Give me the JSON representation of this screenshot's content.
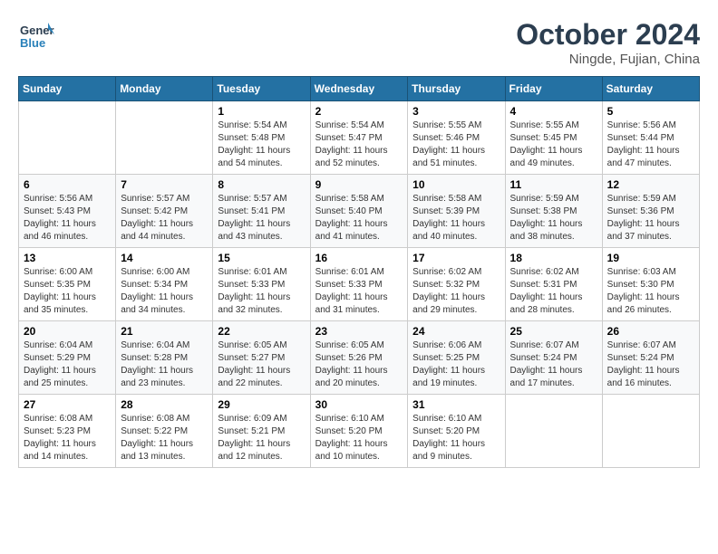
{
  "logo": {
    "general": "General",
    "blue": "Blue"
  },
  "title": "October 2024",
  "location": "Ningde, Fujian, China",
  "days_of_week": [
    "Sunday",
    "Monday",
    "Tuesday",
    "Wednesday",
    "Thursday",
    "Friday",
    "Saturday"
  ],
  "weeks": [
    [
      {
        "day": "",
        "info": ""
      },
      {
        "day": "",
        "info": ""
      },
      {
        "day": "1",
        "info": "Sunrise: 5:54 AM\nSunset: 5:48 PM\nDaylight: 11 hours and 54 minutes."
      },
      {
        "day": "2",
        "info": "Sunrise: 5:54 AM\nSunset: 5:47 PM\nDaylight: 11 hours and 52 minutes."
      },
      {
        "day": "3",
        "info": "Sunrise: 5:55 AM\nSunset: 5:46 PM\nDaylight: 11 hours and 51 minutes."
      },
      {
        "day": "4",
        "info": "Sunrise: 5:55 AM\nSunset: 5:45 PM\nDaylight: 11 hours and 49 minutes."
      },
      {
        "day": "5",
        "info": "Sunrise: 5:56 AM\nSunset: 5:44 PM\nDaylight: 11 hours and 47 minutes."
      }
    ],
    [
      {
        "day": "6",
        "info": "Sunrise: 5:56 AM\nSunset: 5:43 PM\nDaylight: 11 hours and 46 minutes."
      },
      {
        "day": "7",
        "info": "Sunrise: 5:57 AM\nSunset: 5:42 PM\nDaylight: 11 hours and 44 minutes."
      },
      {
        "day": "8",
        "info": "Sunrise: 5:57 AM\nSunset: 5:41 PM\nDaylight: 11 hours and 43 minutes."
      },
      {
        "day": "9",
        "info": "Sunrise: 5:58 AM\nSunset: 5:40 PM\nDaylight: 11 hours and 41 minutes."
      },
      {
        "day": "10",
        "info": "Sunrise: 5:58 AM\nSunset: 5:39 PM\nDaylight: 11 hours and 40 minutes."
      },
      {
        "day": "11",
        "info": "Sunrise: 5:59 AM\nSunset: 5:38 PM\nDaylight: 11 hours and 38 minutes."
      },
      {
        "day": "12",
        "info": "Sunrise: 5:59 AM\nSunset: 5:36 PM\nDaylight: 11 hours and 37 minutes."
      }
    ],
    [
      {
        "day": "13",
        "info": "Sunrise: 6:00 AM\nSunset: 5:35 PM\nDaylight: 11 hours and 35 minutes."
      },
      {
        "day": "14",
        "info": "Sunrise: 6:00 AM\nSunset: 5:34 PM\nDaylight: 11 hours and 34 minutes."
      },
      {
        "day": "15",
        "info": "Sunrise: 6:01 AM\nSunset: 5:33 PM\nDaylight: 11 hours and 32 minutes."
      },
      {
        "day": "16",
        "info": "Sunrise: 6:01 AM\nSunset: 5:33 PM\nDaylight: 11 hours and 31 minutes."
      },
      {
        "day": "17",
        "info": "Sunrise: 6:02 AM\nSunset: 5:32 PM\nDaylight: 11 hours and 29 minutes."
      },
      {
        "day": "18",
        "info": "Sunrise: 6:02 AM\nSunset: 5:31 PM\nDaylight: 11 hours and 28 minutes."
      },
      {
        "day": "19",
        "info": "Sunrise: 6:03 AM\nSunset: 5:30 PM\nDaylight: 11 hours and 26 minutes."
      }
    ],
    [
      {
        "day": "20",
        "info": "Sunrise: 6:04 AM\nSunset: 5:29 PM\nDaylight: 11 hours and 25 minutes."
      },
      {
        "day": "21",
        "info": "Sunrise: 6:04 AM\nSunset: 5:28 PM\nDaylight: 11 hours and 23 minutes."
      },
      {
        "day": "22",
        "info": "Sunrise: 6:05 AM\nSunset: 5:27 PM\nDaylight: 11 hours and 22 minutes."
      },
      {
        "day": "23",
        "info": "Sunrise: 6:05 AM\nSunset: 5:26 PM\nDaylight: 11 hours and 20 minutes."
      },
      {
        "day": "24",
        "info": "Sunrise: 6:06 AM\nSunset: 5:25 PM\nDaylight: 11 hours and 19 minutes."
      },
      {
        "day": "25",
        "info": "Sunrise: 6:07 AM\nSunset: 5:24 PM\nDaylight: 11 hours and 17 minutes."
      },
      {
        "day": "26",
        "info": "Sunrise: 6:07 AM\nSunset: 5:24 PM\nDaylight: 11 hours and 16 minutes."
      }
    ],
    [
      {
        "day": "27",
        "info": "Sunrise: 6:08 AM\nSunset: 5:23 PM\nDaylight: 11 hours and 14 minutes."
      },
      {
        "day": "28",
        "info": "Sunrise: 6:08 AM\nSunset: 5:22 PM\nDaylight: 11 hours and 13 minutes."
      },
      {
        "day": "29",
        "info": "Sunrise: 6:09 AM\nSunset: 5:21 PM\nDaylight: 11 hours and 12 minutes."
      },
      {
        "day": "30",
        "info": "Sunrise: 6:10 AM\nSunset: 5:20 PM\nDaylight: 11 hours and 10 minutes."
      },
      {
        "day": "31",
        "info": "Sunrise: 6:10 AM\nSunset: 5:20 PM\nDaylight: 11 hours and 9 minutes."
      },
      {
        "day": "",
        "info": ""
      },
      {
        "day": "",
        "info": ""
      }
    ]
  ]
}
